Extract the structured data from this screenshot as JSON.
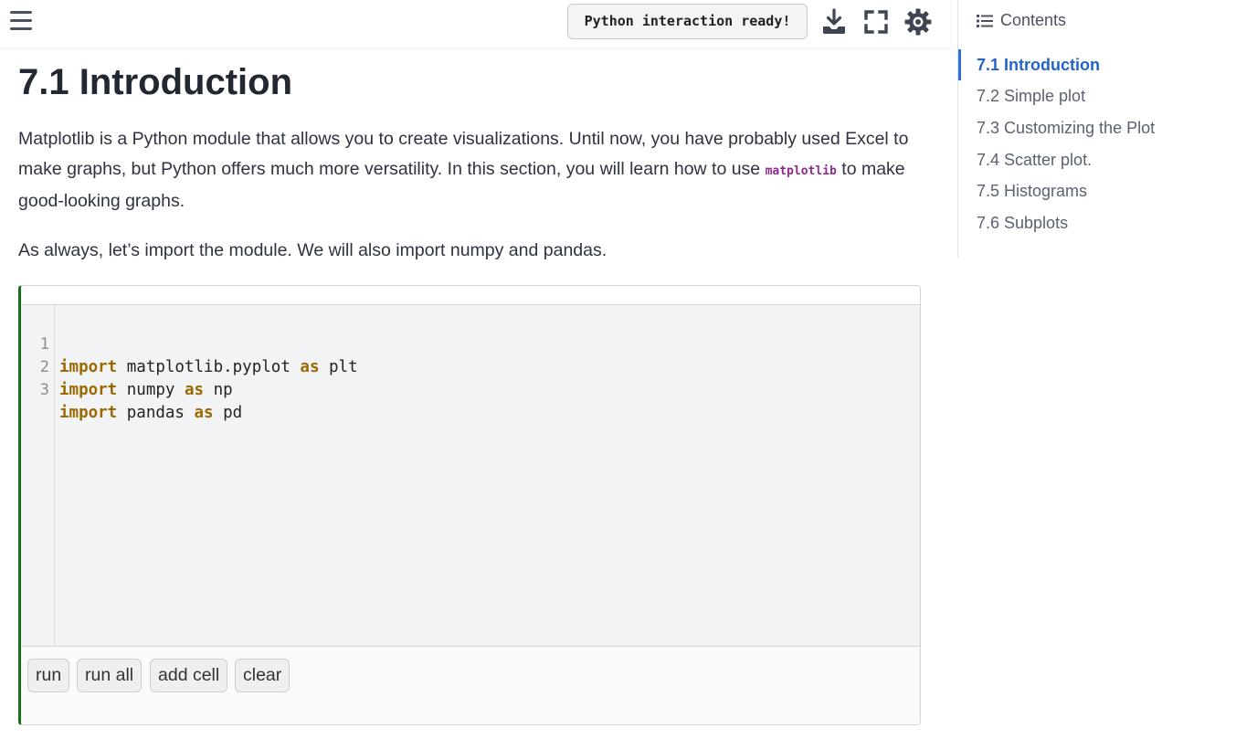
{
  "header": {
    "status": "Python interaction ready!",
    "icons": [
      "menu-icon",
      "download-icon",
      "fullscreen-icon",
      "settings-icon"
    ]
  },
  "article": {
    "title": "7.1 Introduction",
    "para1_part1": "Matplotlib is a Python module that allows you to create visualizations. Until now, you have probably used Excel to make graphs, but Python offers much more versatility. In this section, you will learn how to use ",
    "para1_code": "matplotlib",
    "para1_part2": " to make good-looking graphs.",
    "para2": "As always, let’s import the module. We will also import numpy and pandas."
  },
  "cell": {
    "lines": [
      {
        "num": "1",
        "kw1": "import",
        "mid": " matplotlib.pyplot ",
        "kw2": "as",
        "end": " plt"
      },
      {
        "num": "2",
        "kw1": "import",
        "mid": " numpy ",
        "kw2": "as",
        "end": " np"
      },
      {
        "num": "3",
        "kw1": "import",
        "mid": " pandas ",
        "kw2": "as",
        "end": " pd"
      }
    ],
    "buttons": {
      "run": "run",
      "run_all": "run all",
      "add_cell": "add cell",
      "clear": "clear"
    }
  },
  "toc": {
    "heading": "Contents",
    "items": [
      {
        "label": "7.1 Introduction",
        "active": true
      },
      {
        "label": "7.2 Simple plot",
        "active": false
      },
      {
        "label": "7.3 Customizing the Plot",
        "active": false
      },
      {
        "label": "7.4 Scatter plot.",
        "active": false
      },
      {
        "label": "7.5 Histograms",
        "active": false
      },
      {
        "label": "7.6 Subplots",
        "active": false
      }
    ]
  },
  "colors": {
    "accent": "#2563c9",
    "cell_border": "#167016",
    "keyword": "#9a6a00",
    "inline_code": "#8e2a8e"
  }
}
